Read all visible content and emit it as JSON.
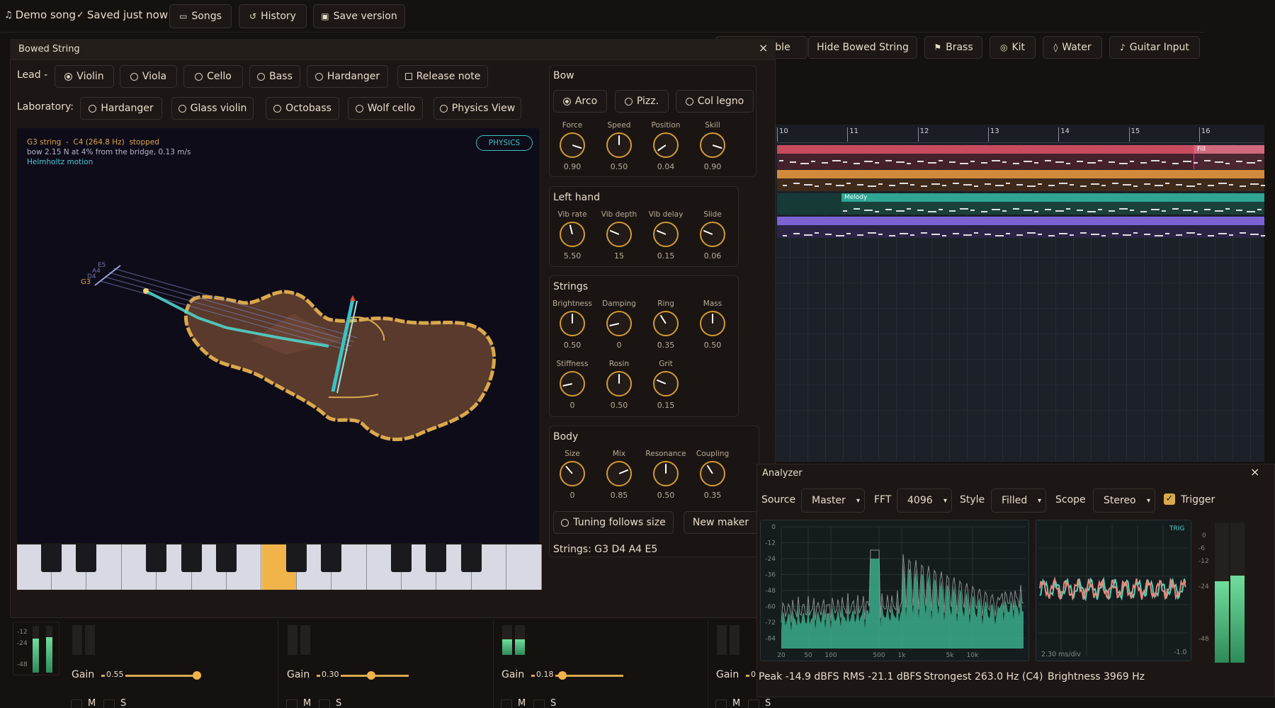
{
  "topbar": {
    "song_title": "Demo song",
    "saved_status": "Saved just now",
    "songs_label": "Songs",
    "history_label": "History",
    "save_version_label": "Save version"
  },
  "instrument_bar": {
    "partial_label": "ble",
    "hide_bowed_label": "Hide Bowed String",
    "brass_label": "Brass",
    "kit_label": "Kit",
    "water_label": "Water",
    "guitar_input_label": "Guitar Input"
  },
  "bowed_window": {
    "title": "Bowed String",
    "lead_label": "Lead -",
    "lead_options": [
      "Violin",
      "Viola",
      "Cello",
      "Bass",
      "Hardanger"
    ],
    "lead_selected": "Violin",
    "release_note_label": "Release note",
    "lab_label": "Laboratory:",
    "lab_options": [
      "Hardanger",
      "Glass violin",
      "Octobass",
      "Wolf cello",
      "Physics View"
    ],
    "physics_badge": "PHYSICS",
    "status_line1": "G3 string  -  C4 (264.8 Hz)  stopped",
    "status_line2": "bow 2.15 N at 4% from the bridge, 0.13 m/s",
    "status_line3": "Helmholtz motion",
    "string_labels": [
      "E5",
      "A4",
      "D4",
      "G3"
    ]
  },
  "bow": {
    "title": "Bow",
    "modes": [
      "Arco",
      "Pizz.",
      "Col legno"
    ],
    "selected": "Arco",
    "knobs": [
      {
        "label": "Force",
        "value": "0.90",
        "level": 0.9
      },
      {
        "label": "Speed",
        "value": "0.50",
        "level": 0.5
      },
      {
        "label": "Position",
        "value": "0.04",
        "level": 0.04
      },
      {
        "label": "Skill",
        "value": "0.90",
        "level": 0.9
      }
    ]
  },
  "left_hand": {
    "title": "Left hand",
    "knobs": [
      {
        "label": "Vib rate",
        "value": "5.50",
        "level": 0.45
      },
      {
        "label": "Vib depth",
        "value": "15",
        "level": 0.25
      },
      {
        "label": "Vib delay",
        "value": "0.15",
        "level": 0.25
      },
      {
        "label": "Slide",
        "value": "0.06",
        "level": 0.25
      }
    ]
  },
  "strings_section": {
    "title": "Strings",
    "knobs_row1": [
      {
        "label": "Brightness",
        "value": "0.50",
        "level": 0.5
      },
      {
        "label": "Damping",
        "value": "0",
        "level": 0.12
      },
      {
        "label": "Ring",
        "value": "0.35",
        "level": 0.38
      },
      {
        "label": "Mass",
        "value": "0.50",
        "level": 0.5
      }
    ],
    "knobs_row2": [
      {
        "label": "Stiffness",
        "value": "0",
        "level": 0.12
      },
      {
        "label": "Rosin",
        "value": "0.50",
        "level": 0.5
      },
      {
        "label": "Grit",
        "value": "0.15",
        "level": 0.25
      }
    ]
  },
  "body_section": {
    "title": "Body",
    "knobs": [
      {
        "label": "Size",
        "value": "0",
        "level": 0.35
      },
      {
        "label": "Mix",
        "value": "0.85",
        "level": 0.75
      },
      {
        "label": "Resonance",
        "value": "0.50",
        "level": 0.5
      },
      {
        "label": "Coupling",
        "value": "0.35",
        "level": 0.38
      }
    ],
    "tuning_label": "Tuning follows size",
    "new_maker_label": "New maker",
    "strings_readout": "Strings: G3 D4 A4 E5"
  },
  "timeline": {
    "bars": [
      "10",
      "11",
      "12",
      "13",
      "14",
      "15",
      "16"
    ],
    "clip_fill_label": "Fill",
    "clip_melody_label": "Melody",
    "colors": {
      "red": "#c94b5f",
      "orange": "#d18a3c",
      "teal": "#2fa593",
      "purple": "#7b63d2"
    }
  },
  "analyzer": {
    "title": "Analyzer",
    "source_label": "Source",
    "source_value": "Master",
    "fft_label": "FFT",
    "fft_value": "4096",
    "style_label": "Style",
    "style_value": "Filled",
    "scope_label": "Scope",
    "scope_value": "Stereo",
    "trigger_label": "Trigger",
    "trigger_checked": true,
    "db_ticks": [
      "0",
      "-12",
      "-24",
      "-36",
      "-48",
      "-60",
      "-72",
      "-84"
    ],
    "freq_ticks": [
      "20",
      "50",
      "100",
      "500",
      "1k",
      "5k",
      "10k"
    ],
    "trig_badge": "TRIG",
    "scope_time": "2.30 ms/div",
    "scope_right": "-1.0",
    "meter_ticks": [
      "0",
      "-6",
      "-12",
      "-24",
      "-48"
    ],
    "peak": "Peak -14.9 dBFS",
    "rms": "RMS -21.1 dBFS",
    "strongest": "Strongest 263.0 Hz (C4)",
    "brightness": "Brightness 3969 Hz"
  },
  "mixer": {
    "left_ticks": [
      "-12",
      "-24",
      "-48"
    ],
    "channels": [
      {
        "gain_label": "Gain",
        "gain_value": "0.55",
        "gain_level": 0.55
      },
      {
        "gain_label": "Gain",
        "gain_value": "0.30",
        "gain_level": 0.3
      },
      {
        "gain_label": "Gain",
        "gain_value": "0.18",
        "gain_level": 0.18
      },
      {
        "gain_label": "Gain",
        "gain_value": "0",
        "gain_level": 0
      }
    ],
    "mute_label": "M",
    "solo_label": "S"
  }
}
